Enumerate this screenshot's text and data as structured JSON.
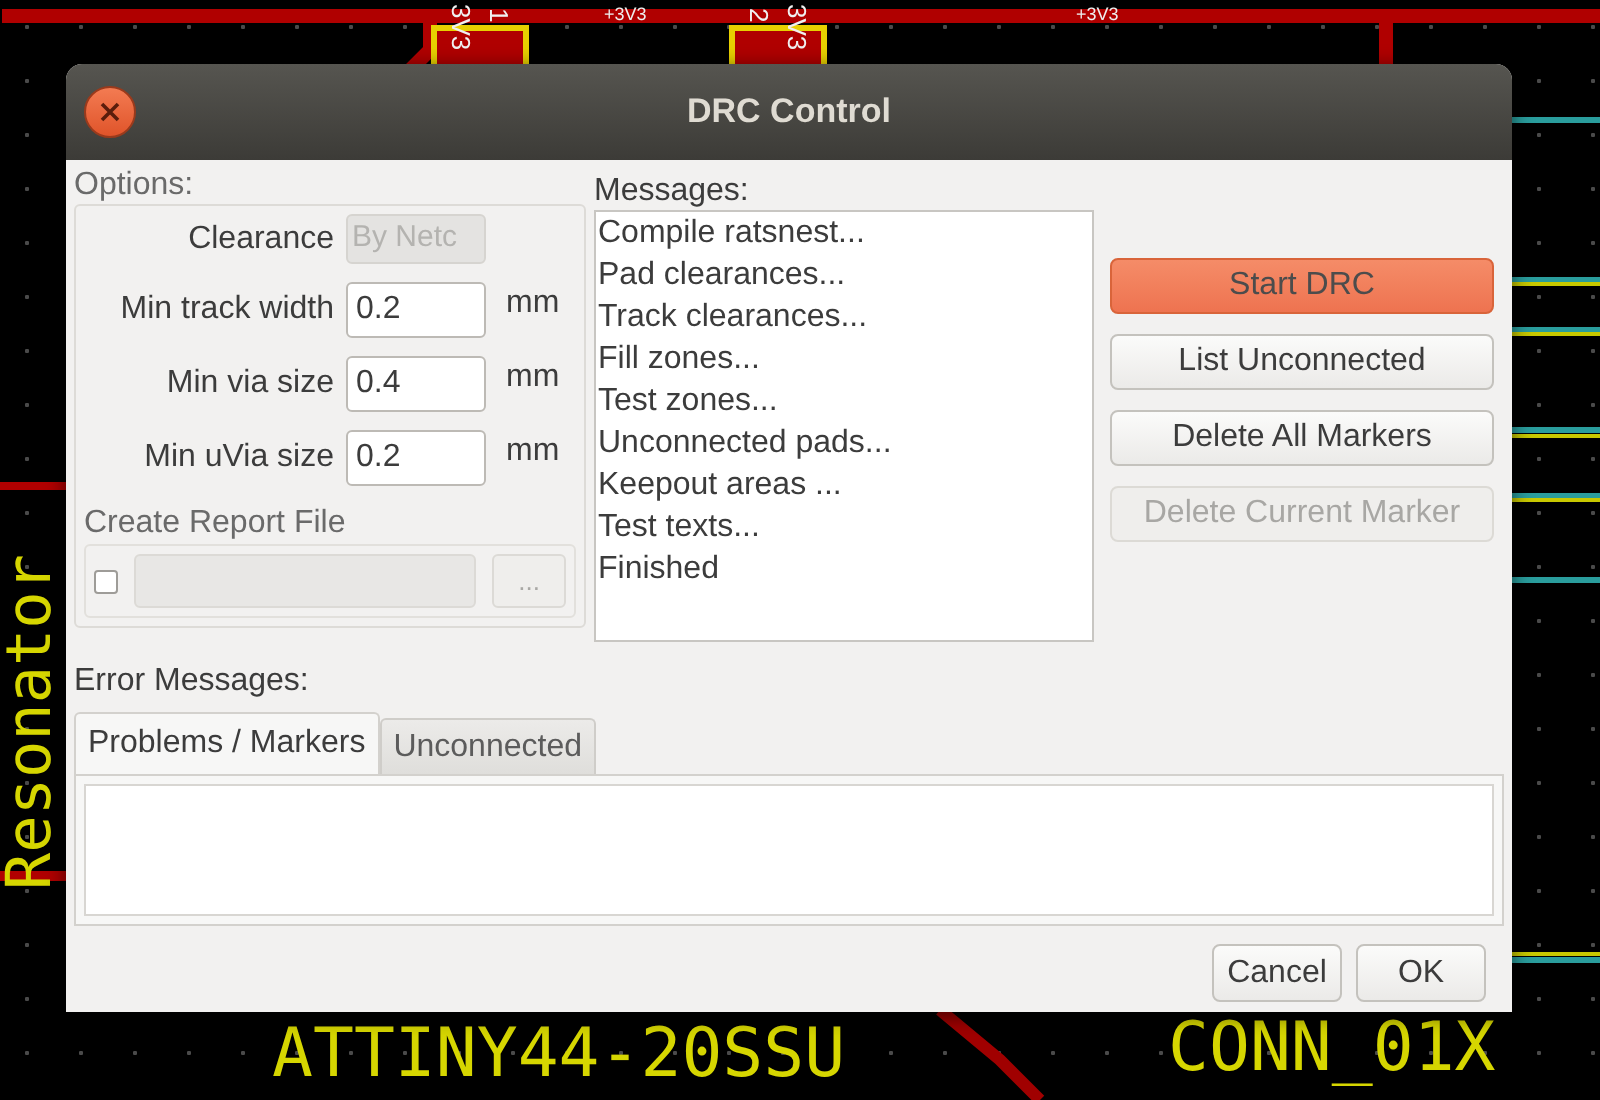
{
  "canvas": {
    "labels": [
      {
        "kind": "net",
        "text": "+3V3"
      },
      {
        "kind": "net",
        "text": "+3V3"
      },
      {
        "kind": "pad",
        "text": "3V3"
      },
      {
        "kind": "pad",
        "text": "1"
      },
      {
        "kind": "pad",
        "text": "2"
      },
      {
        "kind": "pad",
        "text": "3V3"
      },
      {
        "kind": "vertical",
        "text": "Resonator"
      },
      {
        "kind": "part",
        "text": "ATTINY44-20SSU"
      },
      {
        "kind": "part",
        "text": "CONN_01X"
      }
    ]
  },
  "window": {
    "title": "DRC Control"
  },
  "options": {
    "title": "Options:",
    "clearance": {
      "label": "Clearance",
      "value": "By Netc",
      "disabled": true
    },
    "fields": [
      {
        "label": "Min track width",
        "value": "0.2",
        "unit": "mm"
      },
      {
        "label": "Min via size",
        "value": "0.4",
        "unit": "mm"
      },
      {
        "label": "Min uVia size",
        "value": "0.2",
        "unit": "mm"
      }
    ],
    "report": {
      "title": "Create Report File",
      "checked": false,
      "browse": "..."
    }
  },
  "messages": {
    "title": "Messages:",
    "lines": [
      "Compile ratsnest...",
      "Pad clearances...",
      "Track clearances...",
      "Fill zones...",
      "Test zones...",
      "Unconnected pads...",
      "Keepout areas ...",
      "Test texts...",
      "Finished"
    ]
  },
  "actions": [
    {
      "label": "Start DRC",
      "kind": "default",
      "disabled": false
    },
    {
      "label": "List Unconnected",
      "kind": "normal",
      "disabled": false
    },
    {
      "label": "Delete All Markers",
      "kind": "normal",
      "disabled": false
    },
    {
      "label": "Delete Current Marker",
      "kind": "normal",
      "disabled": true
    }
  ],
  "errors": {
    "title": "Error Messages:",
    "tabs": [
      {
        "label": "Problems / Markers",
        "selected": true
      },
      {
        "label": "Unconnected",
        "selected": false
      }
    ]
  },
  "buttons": [
    "Cancel",
    "OK"
  ]
}
